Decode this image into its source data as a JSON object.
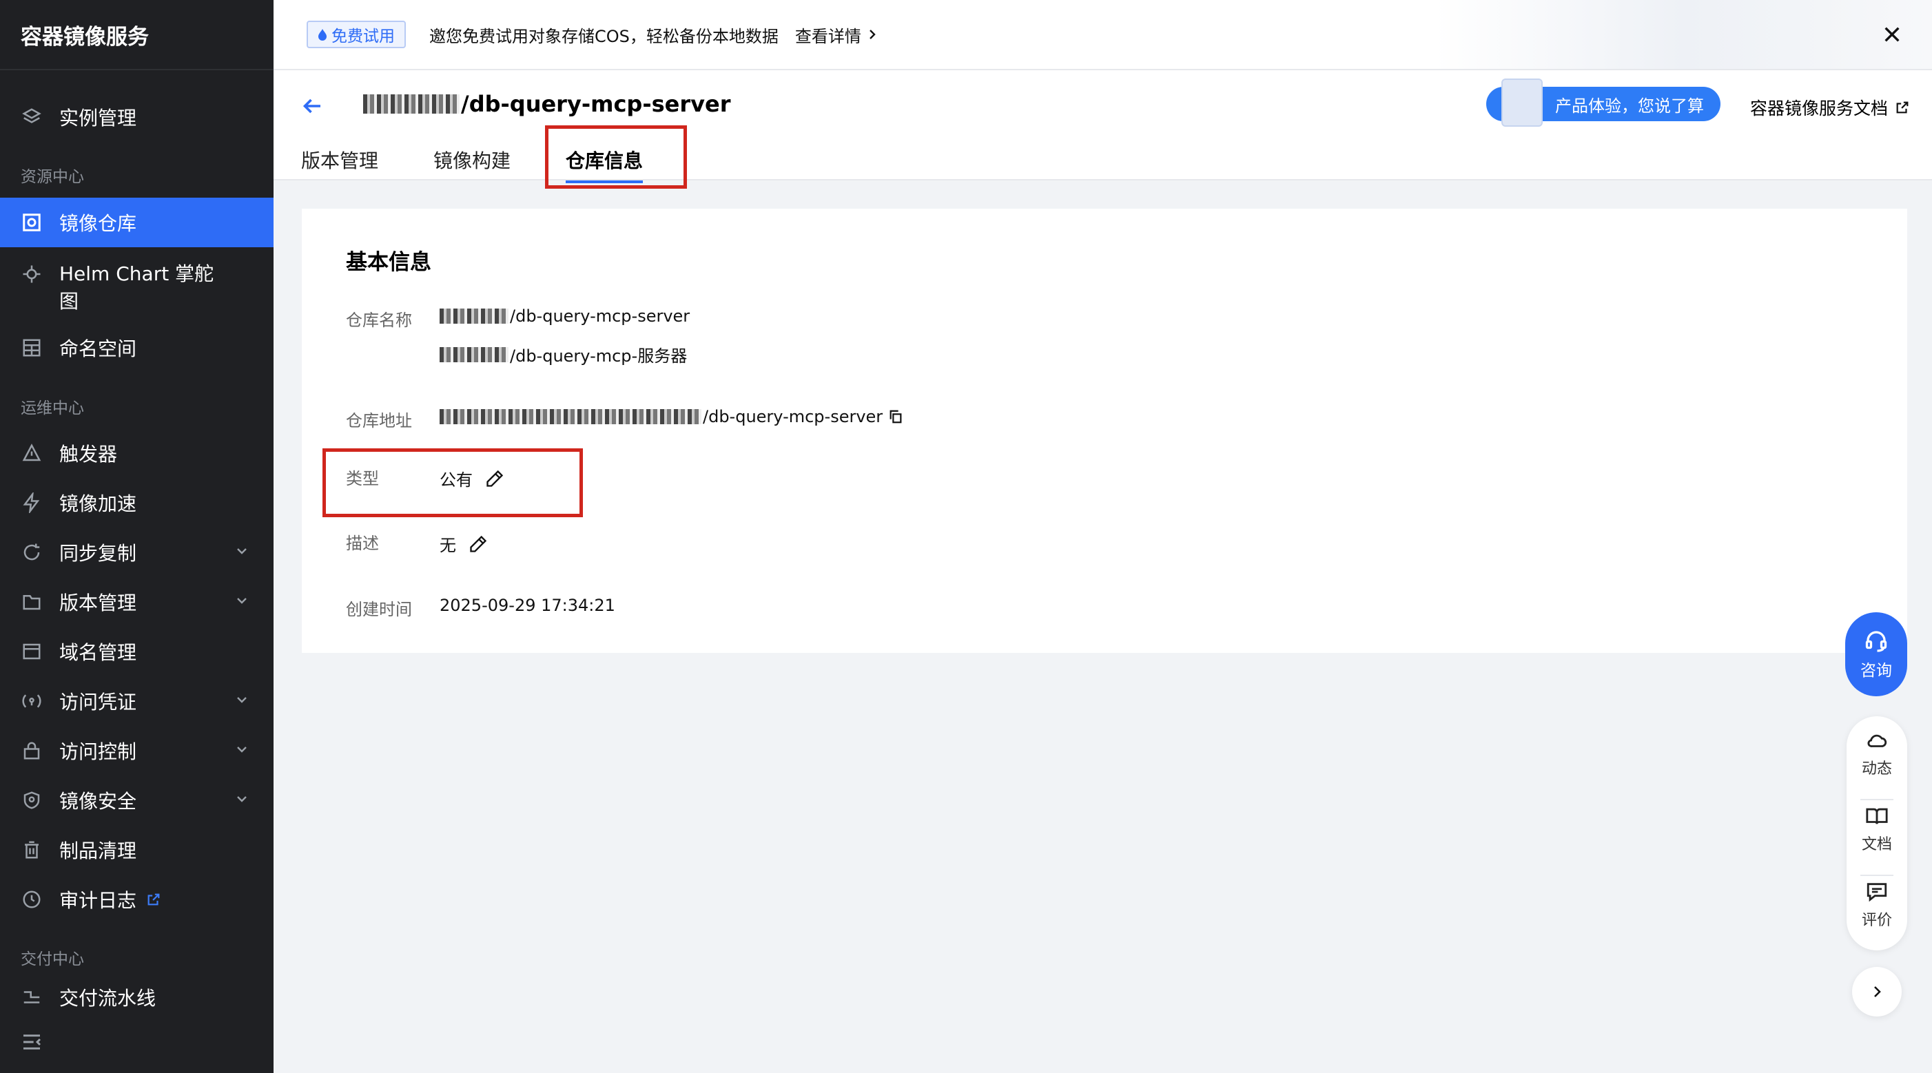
{
  "app": {
    "title": "容器镜像服务"
  },
  "sidebar": {
    "items": [
      {
        "label": "实例管理",
        "icon": "layers-icon"
      },
      {
        "label": "镜像仓库",
        "icon": "repository-icon",
        "active": true
      },
      {
        "label": "Helm Chart 掌舵图",
        "icon": "helm-icon"
      },
      {
        "label": "命名空间",
        "icon": "namespace-icon"
      },
      {
        "label": "触发器",
        "icon": "trigger-icon"
      },
      {
        "label": "镜像加速",
        "icon": "lightning-icon"
      },
      {
        "label": "同步复制",
        "icon": "sync-icon"
      },
      {
        "label": "版本管理",
        "icon": "folder-icon"
      },
      {
        "label": "域名管理",
        "icon": "domain-icon"
      },
      {
        "label": "访问凭证",
        "icon": "credential-icon"
      },
      {
        "label": "访问控制",
        "icon": "lock-icon"
      },
      {
        "label": "镜像安全",
        "icon": "shield-icon"
      },
      {
        "label": "制品清理",
        "icon": "trash-icon"
      },
      {
        "label": "审计日志",
        "icon": "history-icon"
      },
      {
        "label": "交付流水线",
        "icon": "pipeline-icon"
      }
    ],
    "sections": {
      "resource": "资源中心",
      "ops": "运维中心",
      "delivery": "交付中心"
    }
  },
  "banner": {
    "badge": "免费试用",
    "text": "邀您免费试用对象存储COS，轻松备份本地数据",
    "link": "查看详情"
  },
  "header": {
    "repo_suffix": "/db-query-mcp-server",
    "tabs": [
      "版本管理",
      "镜像构建",
      "仓库信息"
    ],
    "active_tab": "仓库信息",
    "feedback": "产品体验，您说了算",
    "doc_link": "容器镜像服务文档"
  },
  "basic_info": {
    "title": "基本信息",
    "name_label": "仓库名称",
    "name_value_1": "/db-query-mcp-server",
    "name_value_2": "/db-query-mcp-服务器",
    "address_label": "仓库地址",
    "address_value": "/db-query-mcp-server",
    "type_label": "类型",
    "type_value": "公有",
    "desc_label": "描述",
    "desc_value": "无",
    "created_label": "创建时间",
    "created_value": "2025-09-29 17:34:21"
  },
  "float_panel": {
    "consult": "咨询",
    "tools": [
      "动态",
      "文档",
      "评价"
    ]
  },
  "colors": {
    "accent": "#2e6cf6",
    "highlight": "#d0261d",
    "sidebar_bg": "#1f2023"
  }
}
